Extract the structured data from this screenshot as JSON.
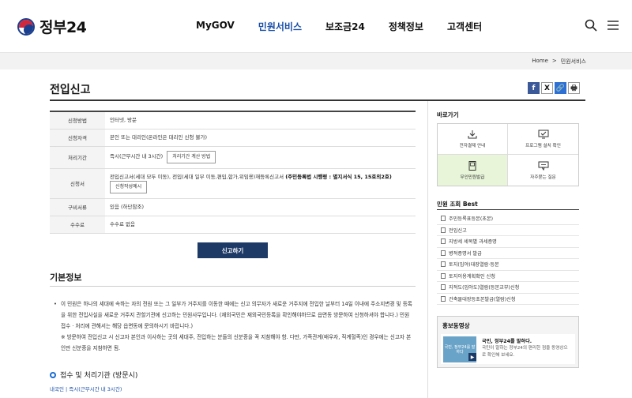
{
  "header": {
    "logo_text": "정부24",
    "nav": [
      {
        "label": "MyGOV",
        "active": false
      },
      {
        "label": "민원서비스",
        "active": true
      },
      {
        "label": "보조금24",
        "active": false
      },
      {
        "label": "정책정보",
        "active": false
      },
      {
        "label": "고객센터",
        "active": false
      }
    ],
    "active_color": "#1a4fa8"
  },
  "breadcrumb": {
    "home": "Home",
    "sep": ">",
    "current": "민원서비스"
  },
  "page": {
    "title": "전입신고"
  },
  "share": {
    "facebook": "f",
    "twitter": "X",
    "link": "🔗",
    "print": "🖶"
  },
  "info_rows": {
    "method": {
      "label": "신청방법",
      "value": "인터넷, 방문"
    },
    "eligibility": {
      "label": "신청자격",
      "value": "본인 또는 대리인(온라인은 대리인 신청 불가)"
    },
    "period": {
      "label": "처리기간",
      "value": "즉시(근무시간 내 3시간)",
      "button": "처리기간 계산 방법"
    },
    "form": {
      "label": "신청서",
      "value_pre": "전입신고서(세대 모두 이동), 전입(세대 일부 이동,편입,합가,위임용)재등록신고서",
      "value_bold": "(주민등록법 시행령 : 별지서식 15, 15호의2호)",
      "button": "신청작성예시"
    },
    "documents": {
      "label": "구비서류",
      "value": "있음 (하단참조)"
    },
    "fee": {
      "label": "수수료",
      "value": "수수료 없음"
    }
  },
  "apply_button": "신고하기",
  "basic_info": {
    "title": "기본정보",
    "bullet": "•",
    "paragraph": "이 민원은 하나의 세대에 속하는 자의 전원 또는 그 일부가 거주지를 이동한 때에는 신고 의무자가 새로운 거주지에 전입한 날부터 14일 이내에 주소지변경 및 등록을 위한 전입사실을 새로운 거주지 관할기관에 신고하는 민원사무입니다. (재외국민은 재외국민등록을 확인해야하므로 읍면동 방문하여 신청하셔야 합니다.) 민원 접수 · 처리에 관해서는 해당 읍면동에 문의하시기 바랍니다.)",
    "note": "※ 방문하여 전입신고 시 신고자 본인과 이사하는 곳의 세대주, 전입하는 분들의 신분증을 꼭 지참해야 함. 다만, 가족관계(배우자, 직계혈족)인 경우에는 신고자 본인만 신분증을 지참하면 됨."
  },
  "reception": {
    "title": "접수 및 처리기관 (방문시)",
    "link": "내국인 | 즉시(근무시간 내 3시간)"
  },
  "aside": {
    "shortcut_title": "바로가기",
    "shortcuts": [
      {
        "label": "전자결제 안내",
        "icon": "download-icon",
        "highlight": false
      },
      {
        "label": "프로그램 설치 확인",
        "icon": "monitor-icon",
        "highlight": false
      },
      {
        "label": "무인민원발급",
        "icon": "kiosk-icon",
        "highlight": true
      },
      {
        "label": "자주묻는 질문",
        "icon": "faq-icon",
        "highlight": false
      }
    ],
    "highlight_color": "#e8f5d9",
    "best_title": "민원 조회 Best",
    "best": [
      "주민등록표등본(초본)",
      "전입신고",
      "지방세 세목별 과세증명",
      "병적증명서 발급",
      "토지(임야)대장열람·등본",
      "토지이용계획확인 신청",
      "지적도(임야도)열람(등본교부)신청",
      "건축물대장등초본발급(열람)신청"
    ],
    "promo_title": "홍보동영상",
    "promo_thumb": "국민, 정부24를 말하다",
    "promo_headline": "국민, 정부24를 말하다.",
    "promo_desc": "국민이 말하는 정부24의 편리한 점을 동영상으로 확인해 보세요."
  }
}
